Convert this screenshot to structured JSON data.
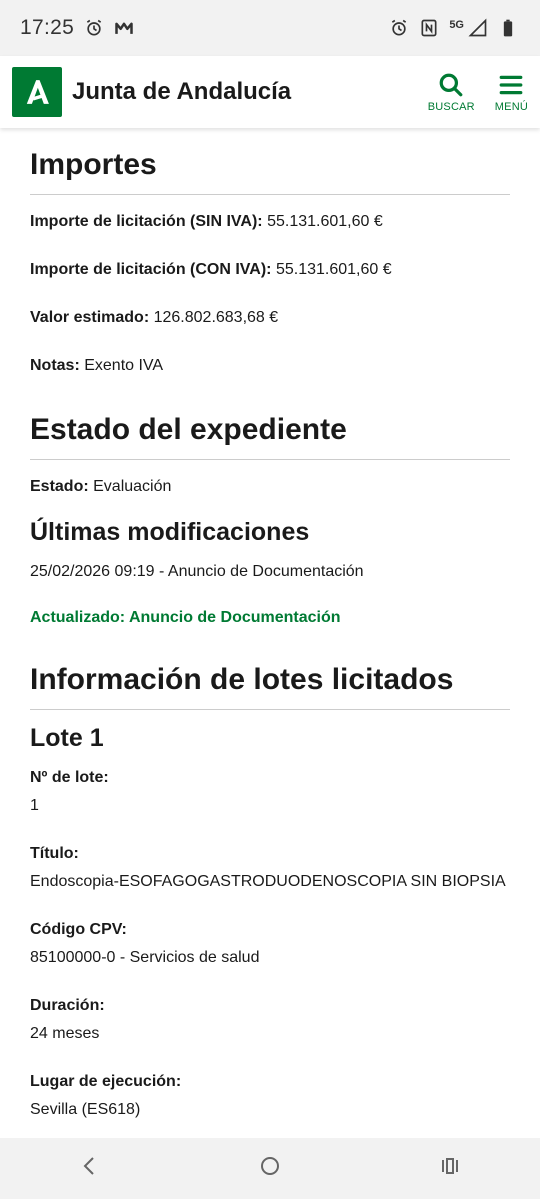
{
  "status_bar": {
    "time": "17:25",
    "network": "5G",
    "icons": [
      "alarm-icon",
      "m-app-icon",
      "nfc-icon",
      "signal-icon",
      "battery-icon"
    ]
  },
  "header": {
    "brand": "Junta de Andalucía",
    "search_label": "BUSCAR",
    "menu_label": "MENÚ",
    "accent": "#007a33"
  },
  "importes": {
    "title": "Importes",
    "sin_iva_label": "Importe de licitación (SIN IVA):",
    "sin_iva_value": " 55.131.601,60 €",
    "con_iva_label": "Importe de licitación (CON IVA):",
    "con_iva_value": " 55.131.601,60 €",
    "valor_label": "Valor estimado:",
    "valor_value": " 126.802.683,68 €",
    "notas_label": "Notas:",
    "notas_value": " Exento IVA"
  },
  "estado": {
    "title": "Estado del expediente",
    "estado_label": "Estado:",
    "estado_value": " Evaluación"
  },
  "modificaciones": {
    "title": "Últimas modificaciones",
    "entry": "25/02/2026 09:19 - Anuncio de Documentación",
    "updated": "Actualizado: Anuncio de Documentación"
  },
  "lotes": {
    "title": "Información de lotes licitados",
    "lote_title": "Lote 1",
    "fields": [
      {
        "label": "Nº de lote:",
        "value": "1"
      },
      {
        "label": "Título:",
        "value": "Endoscopia-ESOFAGOGASTRODUODENOSCOPIA SIN BIOPSIA"
      },
      {
        "label": "Código CPV:",
        "value": "85100000-0 - Servicios de salud"
      },
      {
        "label": "Duración:",
        "value": "24 meses"
      },
      {
        "label": "Lugar de ejecución:",
        "value": "Sevilla (ES618)"
      }
    ]
  },
  "nav_bar": {
    "icons": [
      "back-icon",
      "home-icon",
      "recents-icon"
    ]
  }
}
